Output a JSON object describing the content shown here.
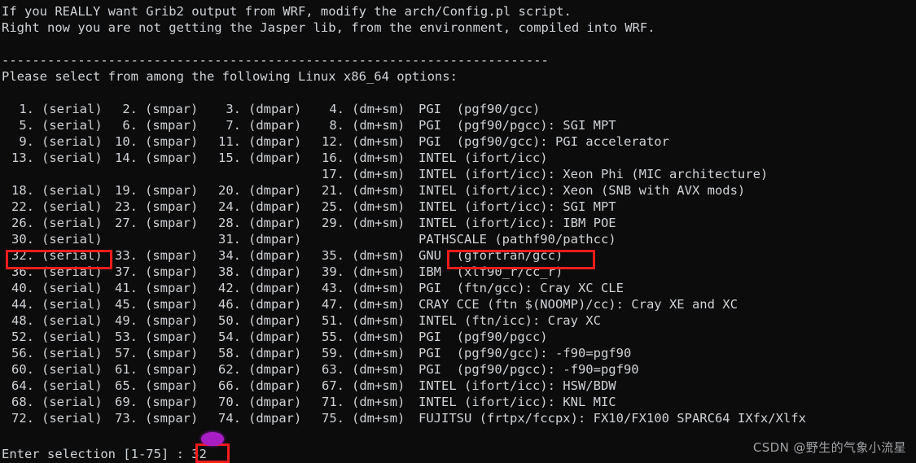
{
  "terminal": {
    "header_lines": [
      "If you REALLY want Grib2 output from WRF, modify the arch/Config.pl script.",
      "Right now you are not getting the Jasper lib, from the environment, compiled into WRF.",
      "",
      "------------------------------------------------------------------------",
      "Please select from among the following Linux x86_64 options:",
      ""
    ],
    "option_rows": [
      {
        "cols": [
          [
            "1.",
            "(serial)"
          ],
          [
            "2.",
            "(smpar)"
          ],
          [
            "3.",
            "(dmpar)"
          ],
          [
            "4.",
            "(dm+sm)"
          ]
        ],
        "desc": "PGI  (pgf90/gcc)"
      },
      {
        "cols": [
          [
            "5.",
            "(serial)"
          ],
          [
            "6.",
            "(smpar)"
          ],
          [
            "7.",
            "(dmpar)"
          ],
          [
            "8.",
            "(dm+sm)"
          ]
        ],
        "desc": "PGI  (pgf90/pgcc): SGI MPT"
      },
      {
        "cols": [
          [
            "9.",
            "(serial)"
          ],
          [
            "10.",
            "(smpar)"
          ],
          [
            "11.",
            "(dmpar)"
          ],
          [
            "12.",
            "(dm+sm)"
          ]
        ],
        "desc": "PGI  (pgf90/gcc): PGI accelerator"
      },
      {
        "cols": [
          [
            "13.",
            "(serial)"
          ],
          [
            "14.",
            "(smpar)"
          ],
          [
            "15.",
            "(dmpar)"
          ],
          [
            "16.",
            "(dm+sm)"
          ]
        ],
        "desc": "INTEL (ifort/icc)"
      },
      {
        "cols": [
          [
            "",
            ""
          ],
          [
            "",
            ""
          ],
          [
            "",
            ""
          ],
          [
            "17.",
            "(dm+sm)"
          ]
        ],
        "desc": "INTEL (ifort/icc): Xeon Phi (MIC architecture)"
      },
      {
        "cols": [
          [
            "18.",
            "(serial)"
          ],
          [
            "19.",
            "(smpar)"
          ],
          [
            "20.",
            "(dmpar)"
          ],
          [
            "21.",
            "(dm+sm)"
          ]
        ],
        "desc": "INTEL (ifort/icc): Xeon (SNB with AVX mods)"
      },
      {
        "cols": [
          [
            "22.",
            "(serial)"
          ],
          [
            "23.",
            "(smpar)"
          ],
          [
            "24.",
            "(dmpar)"
          ],
          [
            "25.",
            "(dm+sm)"
          ]
        ],
        "desc": "INTEL (ifort/icc): SGI MPT"
      },
      {
        "cols": [
          [
            "26.",
            "(serial)"
          ],
          [
            "27.",
            "(smpar)"
          ],
          [
            "28.",
            "(dmpar)"
          ],
          [
            "29.",
            "(dm+sm)"
          ]
        ],
        "desc": "INTEL (ifort/icc): IBM POE"
      },
      {
        "cols": [
          [
            "30.",
            "(serial)"
          ],
          [
            "",
            ""
          ],
          [
            "31.",
            "(dmpar)"
          ],
          [
            "",
            ""
          ]
        ],
        "desc": "PATHSCALE (pathf90/pathcc)"
      },
      {
        "cols": [
          [
            "32.",
            "(serial)"
          ],
          [
            "33.",
            "(smpar)"
          ],
          [
            "34.",
            "(dmpar)"
          ],
          [
            "35.",
            "(dm+sm)"
          ]
        ],
        "desc": "GNU  (gfortran/gcc)"
      },
      {
        "cols": [
          [
            "36.",
            "(serial)"
          ],
          [
            "37.",
            "(smpar)"
          ],
          [
            "38.",
            "(dmpar)"
          ],
          [
            "39.",
            "(dm+sm)"
          ]
        ],
        "desc": "IBM  (xlf90_r/cc_r)"
      },
      {
        "cols": [
          [
            "40.",
            "(serial)"
          ],
          [
            "41.",
            "(smpar)"
          ],
          [
            "42.",
            "(dmpar)"
          ],
          [
            "43.",
            "(dm+sm)"
          ]
        ],
        "desc": "PGI  (ftn/gcc): Cray XC CLE"
      },
      {
        "cols": [
          [
            "44.",
            "(serial)"
          ],
          [
            "45.",
            "(smpar)"
          ],
          [
            "46.",
            "(dmpar)"
          ],
          [
            "47.",
            "(dm+sm)"
          ]
        ],
        "desc": "CRAY CCE (ftn $(NOOMP)/cc): Cray XE and XC"
      },
      {
        "cols": [
          [
            "48.",
            "(serial)"
          ],
          [
            "49.",
            "(smpar)"
          ],
          [
            "50.",
            "(dmpar)"
          ],
          [
            "51.",
            "(dm+sm)"
          ]
        ],
        "desc": "INTEL (ftn/icc): Cray XC"
      },
      {
        "cols": [
          [
            "52.",
            "(serial)"
          ],
          [
            "53.",
            "(smpar)"
          ],
          [
            "54.",
            "(dmpar)"
          ],
          [
            "55.",
            "(dm+sm)"
          ]
        ],
        "desc": "PGI  (pgf90/pgcc)"
      },
      {
        "cols": [
          [
            "56.",
            "(serial)"
          ],
          [
            "57.",
            "(smpar)"
          ],
          [
            "58.",
            "(dmpar)"
          ],
          [
            "59.",
            "(dm+sm)"
          ]
        ],
        "desc": "PGI  (pgf90/gcc): -f90=pgf90"
      },
      {
        "cols": [
          [
            "60.",
            "(serial)"
          ],
          [
            "61.",
            "(smpar)"
          ],
          [
            "62.",
            "(dmpar)"
          ],
          [
            "63.",
            "(dm+sm)"
          ]
        ],
        "desc": "PGI  (pgf90/pgcc): -f90=pgf90"
      },
      {
        "cols": [
          [
            "64.",
            "(serial)"
          ],
          [
            "65.",
            "(smpar)"
          ],
          [
            "66.",
            "(dmpar)"
          ],
          [
            "67.",
            "(dm+sm)"
          ]
        ],
        "desc": "INTEL (ifort/icc): HSW/BDW"
      },
      {
        "cols": [
          [
            "68.",
            "(serial)"
          ],
          [
            "69.",
            "(smpar)"
          ],
          [
            "70.",
            "(dmpar)"
          ],
          [
            "71.",
            "(dm+sm)"
          ]
        ],
        "desc": "INTEL (ifort/icc): KNL MIC"
      },
      {
        "cols": [
          [
            "72.",
            "(serial)"
          ],
          [
            "73.",
            "(smpar)"
          ],
          [
            "74.",
            "(dmpar)"
          ],
          [
            "75.",
            "(dm+sm)"
          ]
        ],
        "desc": "FUJITSU (frtpx/fccpx): FX10/FX100 SPARC64 IXfx/Xlfx"
      }
    ],
    "prompt": {
      "label": "Enter selection [1-75] : ",
      "value": "32"
    }
  },
  "annotations": {
    "box_color": "#f41c1c",
    "highlight_option_label": "32. (serial)",
    "highlight_compiler_label": "GNU  (gfortran/gcc)",
    "highlight_answer_label": "32"
  },
  "cursor": {
    "color": "#a81ec4"
  },
  "watermark": {
    "text": "CSDN @野生的气象小流星"
  }
}
